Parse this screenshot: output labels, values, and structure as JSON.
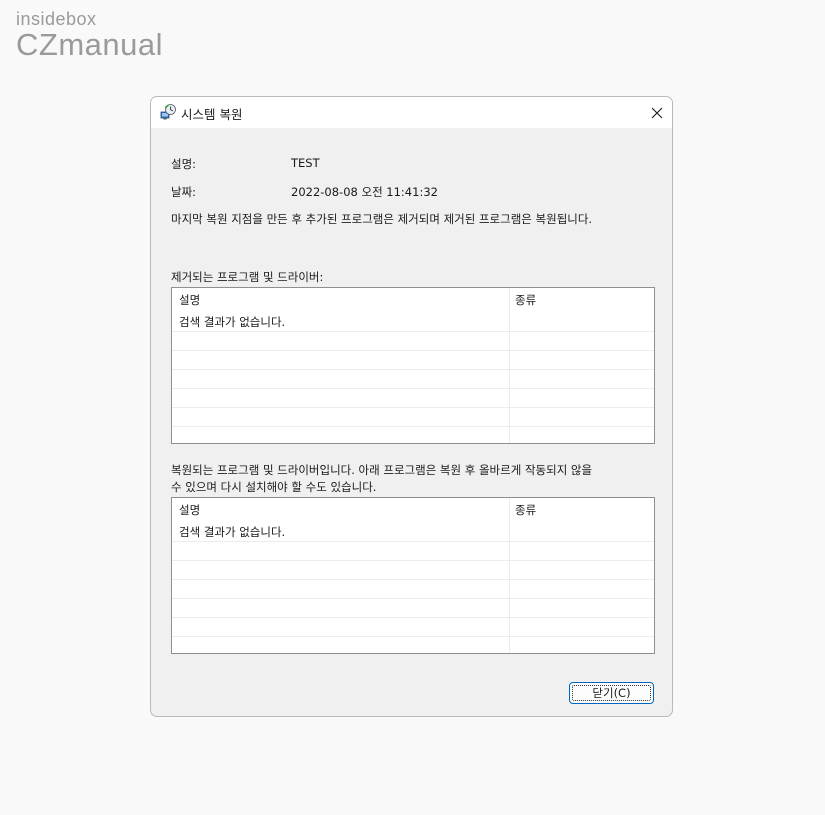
{
  "watermark": {
    "line1": "insidebox",
    "line2": "CZmanual"
  },
  "dialog": {
    "title": "시스템 복원",
    "close_icon": "close-icon",
    "description_label": "설명:",
    "description_value": "TEST",
    "date_label": "날짜:",
    "date_value": "2022-08-08 오전 11:41:32",
    "info_text": "마지막 복원 지점을 만든 후 추가된 프로그램은 제거되며 제거된 프로그램은 복원됩니다.",
    "removed_section": {
      "label": "제거되는 프로그램 및 드라이버:",
      "columns": [
        "설명",
        "종류"
      ],
      "empty_text": "검색 결과가 없습니다."
    },
    "restored_section": {
      "label_line1": "복원되는 프로그램 및 드라이버입니다. 아래 프로그램은 복원 후 올바르게 작동되지 않을",
      "label_line2": "수 있으며 다시 설치해야 할 수도 있습니다.",
      "columns": [
        "설명",
        "종류"
      ],
      "empty_text": "검색 결과가 없습니다."
    },
    "close_button": "닫기(C)"
  },
  "colors": {
    "accent": "#0067c0",
    "dialog_bg": "#f0f0f0",
    "titlebar_bg": "#ffffff"
  }
}
